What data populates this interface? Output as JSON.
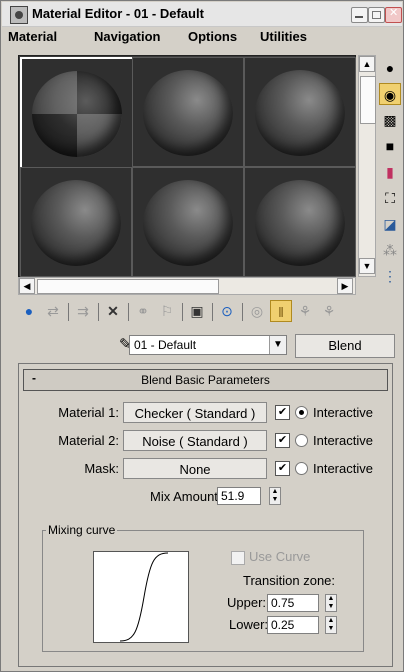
{
  "window": {
    "title": "Material Editor - 01 - Default"
  },
  "menu": [
    "Material",
    "Navigation",
    "Options",
    "Utilities"
  ],
  "slots": {
    "count": 6,
    "active_index": 0
  },
  "right_toolbar_icons": [
    "sample-type-icon",
    "backlight-icon",
    "background-checker-icon",
    "sample-uv-tiling-icon",
    "video-color-check-icon",
    "make-preview-icon",
    "options-icon",
    "select-by-material-icon",
    "material-map-navigator-icon"
  ],
  "bottom_toolbar_icons": [
    "get-material-icon",
    "put-to-scene-icon",
    "assign-to-selection-icon",
    "reset-map-icon",
    "make-unique-icon",
    "put-to-library-icon",
    "material-effects-channel-icon",
    "show-map-in-viewport-icon",
    "show-end-result-icon",
    "go-to-parent-icon",
    "go-forward-to-sibling-icon"
  ],
  "name_bar": {
    "material_name": "01 - Default",
    "type_button": "Blend"
  },
  "rollout": {
    "header": "Blend Basic Parameters",
    "header_toggle": "-",
    "material1": {
      "label": "Material 1:",
      "value": "Checker ( Standard )",
      "checked": true,
      "radio_on": true,
      "radio_label": "Interactive"
    },
    "material2": {
      "label": "Material 2:",
      "value": "Noise ( Standard )",
      "checked": true,
      "radio_on": false,
      "radio_label": "Interactive"
    },
    "mask": {
      "label": "Mask:",
      "value": "None",
      "checked": true,
      "radio_on": false,
      "radio_label": "Interactive"
    },
    "mix_amount": {
      "label": "Mix Amount:",
      "value": "51.9"
    },
    "mixing_curve": {
      "title": "Mixing curve",
      "use_curve_label": "Use Curve",
      "use_curve_checked": false,
      "transition_label": "Transition zone:",
      "upper_label": "Upper:",
      "upper_value": "0.75",
      "lower_label": "Lower:",
      "lower_value": "0.25"
    }
  },
  "glyphs": {
    "check": "✔",
    "spin_up": "▲",
    "spin_down": "▼",
    "scroll_up": "▲",
    "scroll_down": "▼",
    "scroll_left": "◀",
    "scroll_right": "▶",
    "dropdown": "▼",
    "pick": "✎"
  }
}
